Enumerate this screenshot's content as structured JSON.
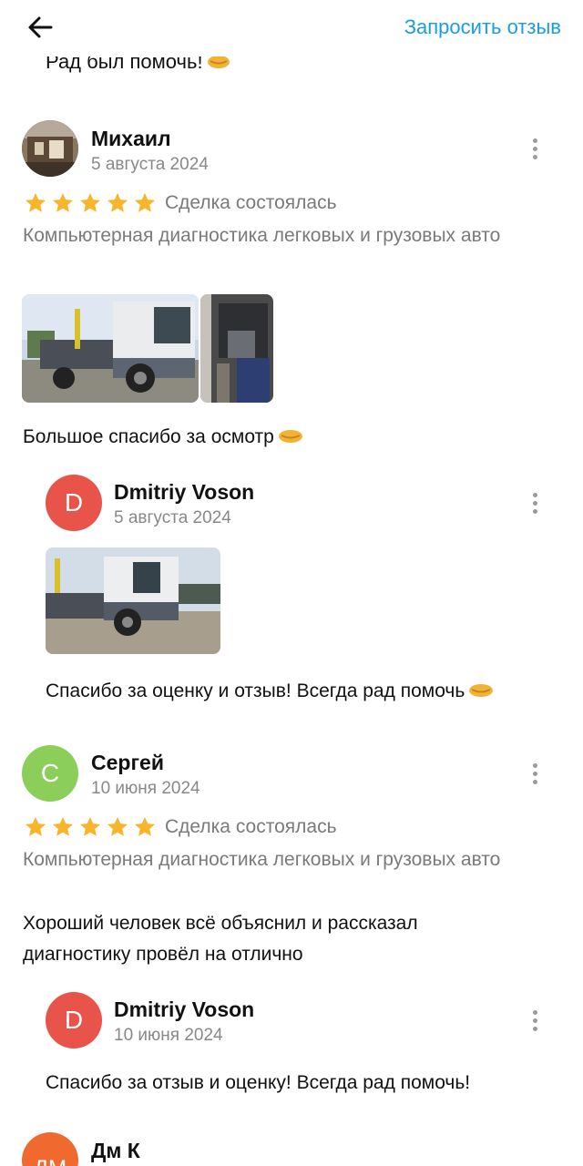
{
  "header": {
    "back_icon": "arrow-left-icon",
    "request_label": "Запросить отзыв"
  },
  "cut_reply_text": "Рад был помочь!",
  "reviews": [
    {
      "author": "Михаил",
      "date": "5 августа 2024",
      "rating": 5,
      "deal_status": "Сделка состоялась",
      "service": "Компьютерная диагностика легковых и грузовых авто",
      "text": "Большое спасибо за осмотр",
      "photos_count": 2,
      "reply": {
        "author": "Dmitriy Voson",
        "avatar_letter": "D",
        "date": "5 августа 2024",
        "text": "Спасибо за оценку и отзыв! Всегда рад помочь"
      }
    },
    {
      "author": "Сергей",
      "avatar_letter": "С",
      "date": "10 июня 2024",
      "rating": 5,
      "deal_status": "Сделка состоялась",
      "service": "Компьютерная диагностика легковых и грузовых авто",
      "text": "Хороший человек всё объяснил и рассказал диагностику провёл на отлично",
      "reply": {
        "author": "Dmitriy Voson",
        "avatar_letter": "D",
        "date": "10 июня 2024",
        "text": "Спасибо за отзыв и оценку! Всегда рад помочь!"
      }
    },
    {
      "author": "Дм К",
      "avatar_letter": "ДМ"
    }
  ],
  "colors": {
    "accent": "#1a9de0",
    "star": "#f7b52c",
    "avatar_red": "#e8534a",
    "avatar_green": "#8bcf5a",
    "muted": "#7a7a7a"
  }
}
